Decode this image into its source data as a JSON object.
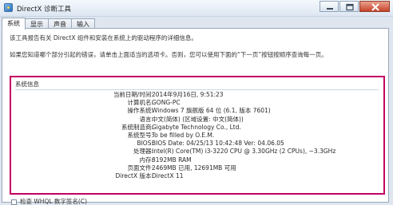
{
  "window": {
    "title": "DirectX 诊断工具",
    "icon": "directx-app-icon"
  },
  "tabs": [
    {
      "label": "系统",
      "active": true
    },
    {
      "label": "显示",
      "active": false
    },
    {
      "label": "声音",
      "active": false
    },
    {
      "label": "输入",
      "active": false
    }
  ],
  "intro": {
    "line1": "该工具报告有关 DirectX 组件和安装在系统上的驱动程序的详细信息。",
    "line2": "如果您知道哪个部分引起的错误，请单击上面适当的选项卡。否则，您可以使用下面的“下一页”按钮按顺序查询每一页。"
  },
  "system_info": {
    "group_title": "系统信息",
    "rows": [
      {
        "label": "当前日期/时间:",
        "value": "2014年9月16日, 9:51:23"
      },
      {
        "label": "计算机名:",
        "value": "GONG-PC"
      },
      {
        "label": "操作系统:",
        "value": "Windows 7 旗舰版 64 位 (6.1, 版本 7601)"
      },
      {
        "label": "语言:",
        "value": "中文(简体) (区域设置: 中文(简体))"
      },
      {
        "label": "系统制造商:",
        "value": "Gigabyte Technology Co., Ltd."
      },
      {
        "label": "系统型号:",
        "value": "To be filled by O.E.M."
      },
      {
        "label": "BIOS:",
        "value": "BIOS Date: 04/25/13 10:42:48 Ver: 04.06.05"
      },
      {
        "label": "处理器:",
        "value": "Intel(R) Core(TM) i3-3220 CPU @ 3.30GHz (2 CPUs), ~3.3GHz"
      },
      {
        "label": "内存:",
        "value": "8192MB RAM"
      },
      {
        "label": "页面文件:",
        "value": "2469MB 已用, 12691MB 可用"
      },
      {
        "label": "DirectX 版本:",
        "value": "DirectX 11"
      }
    ]
  },
  "bottom": {
    "checkbox_text": "检查 WHQL 数字签名(C)"
  },
  "colors": {
    "highlight_border": "#c40061",
    "close_button": "#c8432a"
  }
}
